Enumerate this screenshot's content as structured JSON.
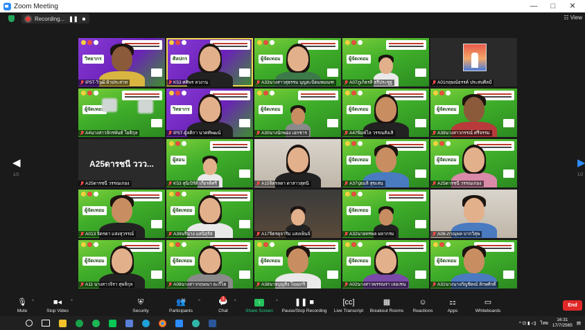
{
  "window": {
    "title": "Zoom Meeting",
    "controls": [
      "—",
      "□",
      "✕"
    ]
  },
  "topbar": {
    "recording_label": "Recording...",
    "pause_symbol": "❚❚",
    "stop_symbol": "■",
    "view_label": "View"
  },
  "nav": {
    "left_page": "1/2",
    "right_page": "1/2"
  },
  "tiles": [
    {
      "name": "IP5T-วิวุฒิ ผิวประสาท",
      "bg": "purple",
      "role": "วิทยากร",
      "person": "dark shirt-yellow"
    },
    {
      "name": "K53 ศศิพร ลวงาน",
      "bg": "purple",
      "role": "ศิลปกร",
      "person": "light long shirt-black",
      "active": true
    },
    {
      "name": "A33นางสาวสุธรรม บุญสะบิดมหมณฑ",
      "bg": "green",
      "role": "ผู้จัดเทอม",
      "person": "light long shirt-green"
    },
    {
      "name": "A07ภูเก็ธรสิ ธรีประชูฐ",
      "bg": "green",
      "role": "ผู้จัดเทอม",
      "person": "small light shirt-white"
    },
    {
      "name": "A01กฤษณ์ธรรค์ ประสบศิลป์",
      "bg": "dark",
      "photo": true
    },
    {
      "name": "A4นางสาวจักรพันธ์ โยธิกุล",
      "bg": "green",
      "role": "ผู้จัดเทอม",
      "blur": true
    },
    {
      "name": "IP5T-ผู้ลดิกา นาคทัพฒน์",
      "bg": "purple",
      "role": "วิทยากร",
      "person": "light long shirt-black"
    },
    {
      "name": "A30นางนักพอง เอกชาร",
      "bg": "green",
      "role": "ผู้จัดเทอม",
      "person": "small shirt-gray"
    },
    {
      "name": "A47พิมพ์ไล วรรณสังเสิ",
      "bg": "green",
      "role": "ผู้จัดเทอม",
      "person": "long shirt-black"
    },
    {
      "name": "A39นางสาวกรรณ์ ศรีจรรม",
      "bg": "green",
      "role": "ผู้จัดเทอม",
      "person": "dark shirt-red"
    },
    {
      "name": "A25ดารชนี วรรณเกอง",
      "bg": "dark",
      "big": "A25ดารชนี ววว..."
    },
    {
      "name": "K53 สุนิเปิร์ดิ เกียรติศรี",
      "bg": "green",
      "role": "ผู้สอน",
      "person": "small light shirt-white"
    },
    {
      "name": "A15จิตรลดา ดาสาวสุดนิ",
      "bg": "room",
      "person": "light long shirt-black"
    },
    {
      "name": "A37ปุยมลิ สุขเสน",
      "bg": "green",
      "role": "ผู้จัดเทอม",
      "person": "shirt-blue"
    },
    {
      "name": "A25ดารชนี วรรณเกอง",
      "bg": "green",
      "role": "ผู้จัดเทอม",
      "person": "light long shirt-pink"
    },
    {
      "name": "A013 จิตรดา แสงสุวรรณ์",
      "bg": "green",
      "role": "ผู้จัดเทอม",
      "person": "shirt-black"
    },
    {
      "name": "A39นรีนาง แสนิสุรัส",
      "bg": "green",
      "role": "ผู้จัดเทอม",
      "person": "light long shirt-white"
    },
    {
      "name": "A17จิตรดุจาริม แสงเพ็นจ์",
      "bg": "curtain",
      "person": "small light long shirt-black"
    },
    {
      "name": "A32นายทรพล ผลากรม",
      "bg": "green",
      "role": "ผู้จัดเทอม",
      "person": "small shirt-black"
    },
    {
      "name": "A06-ภาณุพล บากวิสุพ",
      "bg": "room",
      "person": "light shirt-blue"
    },
    {
      "name": "A11 นางสาวจิรา สุพลิกุล",
      "bg": "green",
      "role": "ผู้จัดเทอม",
      "person": "light long shirt-black"
    },
    {
      "name": "A08นางสาวกฤษณา ยะกีไต",
      "bg": "green",
      "role": "ผู้จัดเทอม",
      "person": "light long shirt-gray"
    },
    {
      "name": "A38นายบุญสิง โณมกริ",
      "bg": "green",
      "role": "ผู้จัดเทอม",
      "person": "shirt-white"
    },
    {
      "name": "A02นางสาวพรรณรา เลอเชน",
      "bg": "green",
      "role": "ผู้จัดเทอม",
      "person": "light long shirt-purple"
    },
    {
      "name": "A31นางนางกัญชิตณ์ ลักษศักดิ์",
      "bg": "green",
      "role": "ผู้จัดเทอม",
      "person": "shirt-blue"
    }
  ],
  "toolbar": {
    "mute": "Mute",
    "stop_video": "Stop Video",
    "security": "Security",
    "participants": "Participants",
    "participants_count": "36",
    "chat": "Chat",
    "chat_badge": "1",
    "share_screen": "Share Screen",
    "pause_recording": "Pause/Stop Recording",
    "live_transcript": "Live Transcript",
    "breakout_rooms": "Breakout Rooms",
    "reactions": "Reactions",
    "apps": "Apps",
    "whiteboards": "Whiteboards",
    "end": "End"
  },
  "taskbar": {
    "time": "16:31",
    "date": "17/7/2565",
    "lang": "ไทย",
    "tray_symbols": "^ ⊡ ▮ ◁)"
  },
  "colors": {
    "accent": "#23c25b",
    "end": "#e02828",
    "active_speaker": "#f2d94e"
  }
}
